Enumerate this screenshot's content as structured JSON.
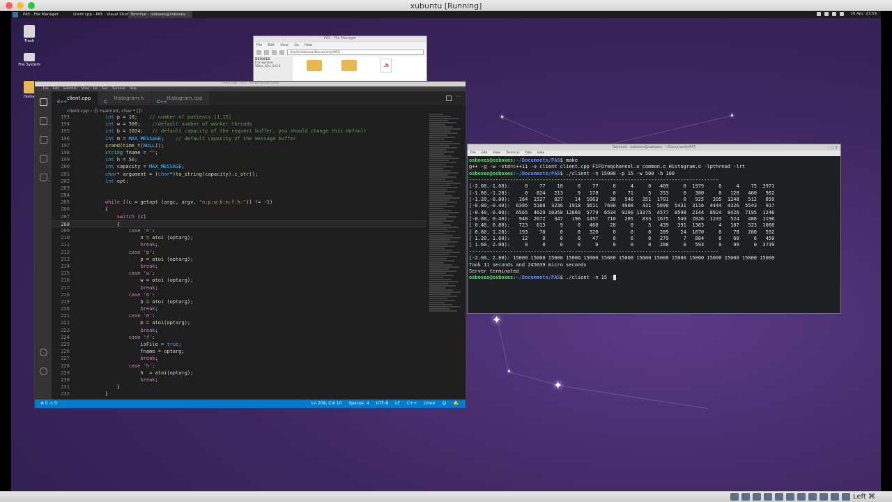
{
  "host": {
    "title": "xubuntu [Running]",
    "host_key": "Left ⌘"
  },
  "panel": {
    "tasks": [
      "PA5 - File Manager",
      "client.cpp - PA5 - Visual Studi...",
      "Terminal - osboxes@osboxes:..."
    ],
    "clock": "16 Apr, 23:59"
  },
  "desktop": {
    "icons": [
      "Trash",
      "File System",
      "Home"
    ]
  },
  "file_manager": {
    "title": "PA5 - File Manager",
    "menu": [
      "File",
      "Edit",
      "View",
      "Go",
      "Help"
    ],
    "path": "/home/osboxes/Documents/PA5/",
    "side_header": "DEVICES",
    "side_items": [
      "File System",
      "VBox_GAs_6.0.6"
    ],
    "h_label": ".h"
  },
  "vscode": {
    "title": "client.cpp - PA5 - Visual Studio Code",
    "menu": [
      "File",
      "Edit",
      "Selection",
      "View",
      "Go",
      "Run",
      "Terminal",
      "Help"
    ],
    "tabs": [
      {
        "label": "client.cpp",
        "icon": "C++"
      },
      {
        "label": "Histogram.h",
        "icon": "C"
      },
      {
        "label": "Histogram.cpp",
        "icon": "C++"
      }
    ],
    "breadcrumb": "client.cpp  ›  ⓜ main(int, char * [])",
    "status_left": "⊗ 0  ⚠ 0",
    "status_right": [
      "Ln 208, Col 10",
      "Spaces: 4",
      "UTF-8",
      "LF",
      "C++",
      "Linux",
      "☺",
      "🔔"
    ],
    "code": [
      {
        "n": "193",
        "html": "    <span class=\"kw\">int</span> p = <span class=\"num\">10</span>;    <span class=\"cm\">// number of patients [1,15]</span>"
      },
      {
        "n": "194",
        "html": "    <span class=\"kw\">int</span> w = <span class=\"num\">500</span>;    <span class=\"cm\">//default number of worker threads</span>"
      },
      {
        "n": "195",
        "html": "    <span class=\"kw\">int</span> b = <span class=\"num\">1024</span>;   <span class=\"cm\">// default capacity of the request buffer, you should change this default</span>"
      },
      {
        "n": "196",
        "html": "    <span class=\"kw\">int</span> m = <span class=\"mac\">MAX_MESSAGE</span>;    <span class=\"cm\">// default capacity of the message buffer</span>"
      },
      {
        "n": "197",
        "html": "    <span class=\"fn\">srand</span>(<span class=\"fn\">time_t</span>(<span class=\"mac\">NULL</span>));"
      },
      {
        "n": "198",
        "html": "    <span class=\"ty\">string</span> fname = <span class=\"str\">\"\"</span>;"
      },
      {
        "n": "199",
        "html": "    <span class=\"kw\">int</span> h = <span class=\"num\">50</span>;"
      },
      {
        "n": "200",
        "html": "    <span class=\"kw\">int</span> capacity = <span class=\"mac\">MAX_MESSAGE</span>;"
      },
      {
        "n": "201",
        "html": "    <span class=\"kw\">char</span>* argument = (<span class=\"kw\">char</span>*)<span class=\"fn\">to_string</span>(capacity).<span class=\"fn\">c_str</span>();"
      },
      {
        "n": "202",
        "html": "    <span class=\"kw\">int</span> opt;"
      },
      {
        "n": "203",
        "html": ""
      },
      {
        "n": "204",
        "html": ""
      },
      {
        "n": "205",
        "html": "    <span class=\"ctl\">while</span> ((c = <span class=\"fn\">getopt</span> (argc, argv, <span class=\"str\">\"n:p:w:b:m:f:h:\"</span>)) != <span class=\"num\">-1</span>)"
      },
      {
        "n": "206",
        "html": "    {"
      },
      {
        "n": "207",
        "html": "        <span class=\"ctl\">switch</span> (c)"
      },
      {
        "n": "208",
        "html": "        {",
        "cur": true
      },
      {
        "n": "209",
        "html": "            <span class=\"ctl\">case</span> <span class=\"str\">'n'</span>:"
      },
      {
        "n": "210",
        "html": "                n = <span class=\"fn\">atoi</span> (optarg);"
      },
      {
        "n": "211",
        "html": "                <span class=\"ctl\">break</span>;"
      },
      {
        "n": "212",
        "html": "            <span class=\"ctl\">case</span> <span class=\"str\">'p'</span>:"
      },
      {
        "n": "213",
        "html": "                p = <span class=\"fn\">atoi</span> (optarg);"
      },
      {
        "n": "214",
        "html": "                <span class=\"ctl\">break</span>;"
      },
      {
        "n": "215",
        "html": "            <span class=\"ctl\">case</span> <span class=\"str\">'w'</span>:"
      },
      {
        "n": "216",
        "html": "                w = <span class=\"fn\">atoi</span> (optarg);"
      },
      {
        "n": "217",
        "html": "                <span class=\"ctl\">break</span>;"
      },
      {
        "n": "218",
        "html": "            <span class=\"ctl\">case</span> <span class=\"str\">'b'</span>:"
      },
      {
        "n": "219",
        "html": "                b = <span class=\"fn\">atoi</span> (optarg);"
      },
      {
        "n": "220",
        "html": "                <span class=\"ctl\">break</span>;"
      },
      {
        "n": "221",
        "html": "            <span class=\"ctl\">case</span> <span class=\"str\">'m'</span>:"
      },
      {
        "n": "222",
        "html": "                m = <span class=\"fn\">atoi</span>(optarg);"
      },
      {
        "n": "223",
        "html": "                <span class=\"ctl\">break</span>;"
      },
      {
        "n": "224",
        "html": "            <span class=\"ctl\">case</span> <span class=\"str\">'f'</span>:"
      },
      {
        "n": "225",
        "html": "                isFile = <span class=\"kw\">true</span>;"
      },
      {
        "n": "226",
        "html": "                fname = optarg;"
      },
      {
        "n": "227",
        "html": "                <span class=\"ctl\">break</span>;"
      },
      {
        "n": "228",
        "html": "            <span class=\"ctl\">case</span> <span class=\"str\">'h'</span>:"
      },
      {
        "n": "229",
        "html": "                h  = <span class=\"fn\">atoi</span>(optarg);"
      },
      {
        "n": "230",
        "html": "                <span class=\"ctl\">break</span>;"
      },
      {
        "n": "231",
        "html": "        }"
      },
      {
        "n": "232",
        "html": "    }"
      }
    ]
  },
  "terminal": {
    "title": "Terminal - osboxes@osboxes: ~/Documents/PA5",
    "menu": [
      "File",
      "Edit",
      "View",
      "Terminal",
      "Tabs",
      "Help"
    ],
    "user": "osboxes@osboxes",
    "path": ":~/Documents/PA5",
    "lines": [
      {
        "prompt": true,
        "cmd": "$ make"
      },
      {
        "text": "g++ -g -w -std=c++11 -o client client.cpp FIFOreqchannel.o common.o Histogram.o -lpthread -lrt"
      },
      {
        "prompt": true,
        "cmd": "$ ./client -n 15000 -p 15 -w 500 -b 100"
      },
      {
        "text": "-------------------------------------------------------------------------------------"
      },
      {
        "text": "[-2.00,-1.60):     0    77    10     0    77     0     4     0   409     0  1979     0     4    75  3971"
      },
      {
        "text": "[-1.60,-1.20):     0   824   213     9   178     0    71     5   253     0   380     0   128   460   962"
      },
      {
        "text": "[-1.20,-0.80):   164  1527   827    14  1063    38   546   351  1701     0   925   395  1248   512   859"
      },
      {
        "text": "[-0.80,-0.40):  6395  5188  3236  1918  5611  7698  4908   431  5090  5431  3116  4444  4326  5543   917"
      },
      {
        "text": "[-0.40,-0.00):  6565  4629 10358 12869  5779  6534  9266 13375  4577  8598  2144  8924  8426  7195  1246"
      },
      {
        "text": "[-0.00, 0.40):   948  2072   347   190  1457   710   205   833  1675   549  2026  1233   524   486  1196"
      },
      {
        "text": "[ 0.40, 0.80):   723   613     9     0   468    20     0     5   439   391  1363     4   107   523  1068"
      },
      {
        "text": "[ 0.80, 1.20):   193    70     0     0   320     0     0     0   289    24  1670     0    78   200   592"
      },
      {
        "text": "[ 1.20, 1.60):    12     0     0     0    47     0     0     0   279     7   804     0    60     6   450"
      },
      {
        "text": "[ 1.60, 2.00):     0     0     0     0     0     0     0     0   288     0   593     0    99     0  3739"
      },
      {
        "text": "-------------------------------------------------------------------------------------"
      },
      {
        "text": "[-2.00, 2.00): 15000 15000 15000 15000 15000 15000 15000 15000 15000 15000 15000 15000 15000 15000 15000"
      },
      {
        "text": "Took 11 seconds and 245039 micro seconds"
      },
      {
        "text": "Server terminated"
      },
      {
        "prompt": true,
        "cmd": "$ ./client -n 15 -",
        "cursor": true
      }
    ]
  }
}
